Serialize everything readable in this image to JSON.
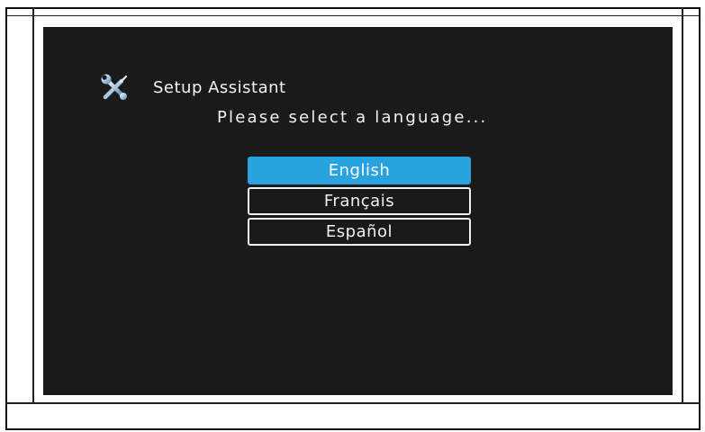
{
  "setup": {
    "title": "Setup Assistant",
    "icon": "tools-icon",
    "prompt": "Please select a language..."
  },
  "languages": {
    "options": [
      "English",
      "Français",
      "Español"
    ],
    "selected": "English"
  },
  "colors": {
    "screen_background": "#1a1a1a",
    "selection_highlight": "#29a3df",
    "text": "#f2f2f2"
  }
}
